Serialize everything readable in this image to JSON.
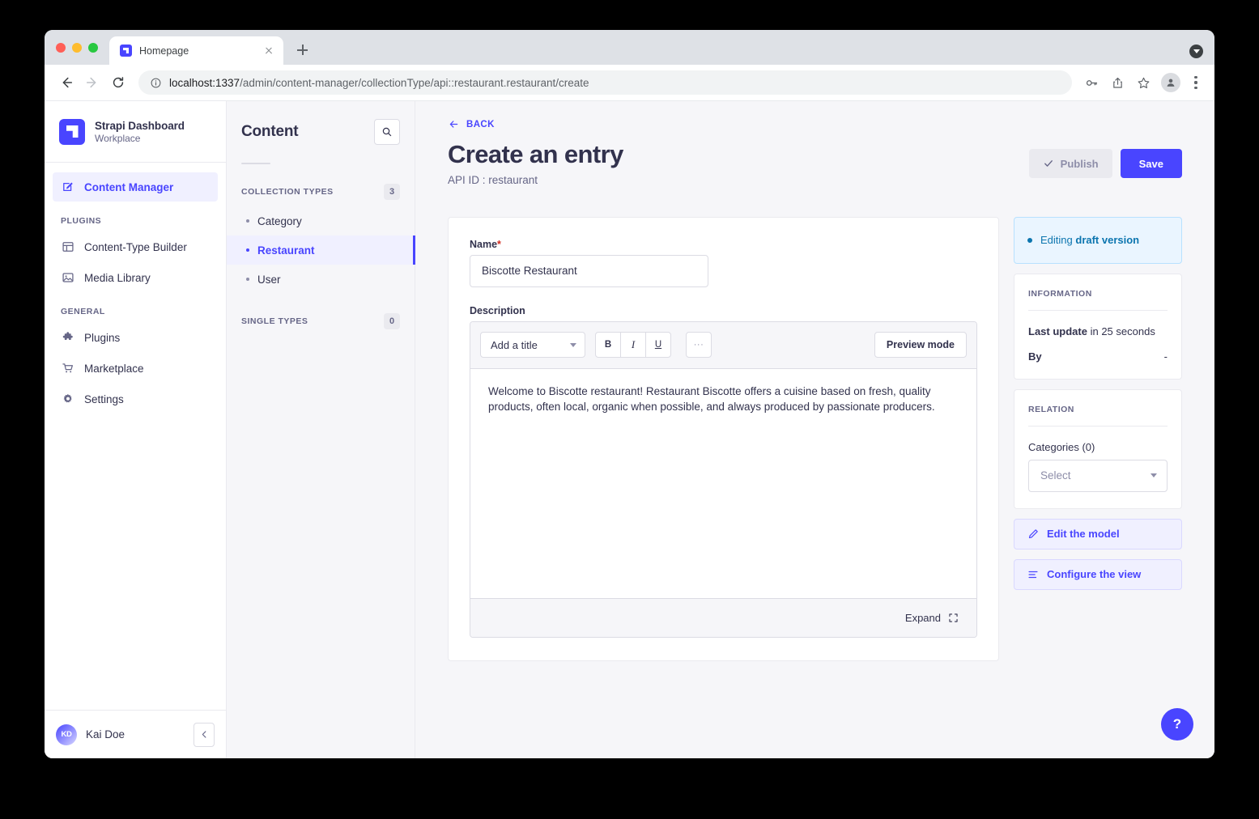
{
  "browser": {
    "tab": {
      "title": "Homepage",
      "favicon": "strapi-logo-icon"
    },
    "url_display_host": "localhost:1337",
    "url_display_path": "/admin/content-manager/collectionType/api::restaurant.restaurant/create",
    "toolbar_icons": [
      "back-icon",
      "forward-icon",
      "reload-icon",
      "info-icon",
      "key-icon",
      "share-icon",
      "star-icon",
      "profile-icon",
      "kebab-menu-icon"
    ]
  },
  "nav": {
    "brand": {
      "name": "Strapi Dashboard",
      "sub": "Workplace"
    },
    "primary": [
      {
        "label": "Content Manager",
        "icon": "pencil-square-icon",
        "active": true
      }
    ],
    "sections": [
      {
        "title": "PLUGINS",
        "items": [
          {
            "label": "Content-Type Builder",
            "icon": "layout-icon"
          },
          {
            "label": "Media Library",
            "icon": "image-icon"
          }
        ]
      },
      {
        "title": "GENERAL",
        "items": [
          {
            "label": "Plugins",
            "icon": "puzzle-icon"
          },
          {
            "label": "Marketplace",
            "icon": "cart-icon"
          },
          {
            "label": "Settings",
            "icon": "gear-icon"
          }
        ]
      }
    ],
    "footer": {
      "initials": "KD",
      "user": "Kai Doe",
      "collapse_icon": "chevron-left-icon"
    }
  },
  "content_list": {
    "title": "Content",
    "search_icon": "search-icon",
    "collection_types": {
      "label": "COLLECTION TYPES",
      "count": "3",
      "items": [
        {
          "label": "Category",
          "active": false
        },
        {
          "label": "Restaurant",
          "active": true
        },
        {
          "label": "User",
          "active": false
        }
      ]
    },
    "single_types": {
      "label": "SINGLE TYPES",
      "count": "0"
    }
  },
  "main": {
    "back_label": "BACK",
    "title": "Create an entry",
    "subtitle": "API ID : restaurant",
    "publish_label": "Publish",
    "save_label": "Save",
    "form": {
      "name_label": "Name",
      "name_required": "*",
      "name_value": "Biscotte Restaurant",
      "name_placeholder": "",
      "description_label": "Description",
      "editor": {
        "title_select": "Add a title",
        "bold": "B",
        "italic": "I",
        "underline": "U",
        "more": "···",
        "preview_label": "Preview mode",
        "body": "Welcome to Biscotte restaurant! Restaurant Biscotte offers a cuisine based on fresh, quality products, often local, organic when possible, and always produced by passionate producers.",
        "expand_label": "Expand",
        "expand_icon": "fullscreen-icon"
      }
    }
  },
  "rail": {
    "draft_prefix": "Editing ",
    "draft_strong": "draft version",
    "information": {
      "title": "INFORMATION",
      "rows": [
        {
          "label": "Last update",
          "value": "in 25 seconds"
        },
        {
          "label": "By",
          "value": "-"
        }
      ]
    },
    "relation": {
      "title": "RELATION",
      "field_label": "Categories (0)",
      "select_placeholder": "Select"
    },
    "actions": [
      {
        "label": "Edit the model",
        "icon": "pencil-icon"
      },
      {
        "label": "Configure the view",
        "icon": "sliders-icon"
      }
    ]
  },
  "help": {
    "label": "?",
    "icon": "question-mark-icon"
  },
  "colors": {
    "accent": "#4945ff",
    "accent_soft": "#f0f0ff",
    "text": "#32324d",
    "muted": "#666687",
    "app_bg": "#f6f6f9",
    "border": "#eaeaef",
    "danger": "#d02b20",
    "info": "#0c75af",
    "info_bg": "#eaf5ff"
  }
}
